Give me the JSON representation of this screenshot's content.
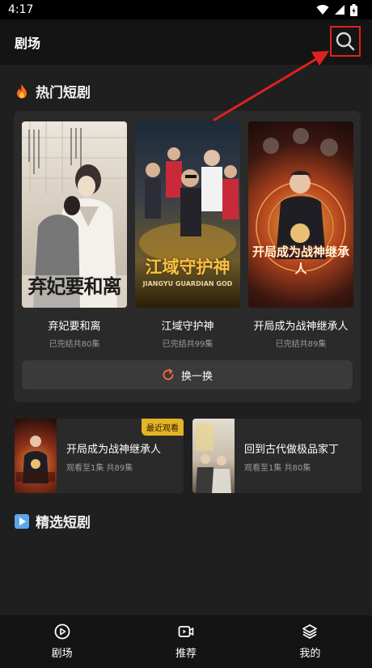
{
  "status_bar": {
    "time": "4:17"
  },
  "header": {
    "title": "剧场",
    "search_icon": "search-icon"
  },
  "hot_section": {
    "title": "热门短剧",
    "icon": "flame-icon",
    "items": [
      {
        "name": "弃妃要和离",
        "meta": "已完结共80集",
        "poster_text": "弃妃要和离"
      },
      {
        "name": "江域守护神",
        "meta": "已完结共99集",
        "poster_text": "江域守护神",
        "poster_subtext": "JIANGYU GUARDIAN GOD"
      },
      {
        "name": "开局成为战神继承人",
        "meta": "已完结共89集",
        "poster_text": "开局成为战神继承人"
      }
    ],
    "refresh_label": "换一换"
  },
  "recent": [
    {
      "title": "开局成为战神继承人",
      "meta": "观看至1集 共89集",
      "badge": "最近观看"
    },
    {
      "title": "回到古代做极品家丁",
      "meta": "观看至1集 共80集"
    }
  ],
  "featured_section": {
    "title": "精选短剧",
    "icon": "play-icon"
  },
  "bottom_nav": [
    {
      "label": "剧场",
      "icon": "play-circle-icon"
    },
    {
      "label": "推荐",
      "icon": "video-icon"
    },
    {
      "label": "我的",
      "icon": "layers-icon"
    }
  ],
  "colors": {
    "accent_red": "#e02020",
    "badge_gold": "#e6b326",
    "panel": "#2a2a2a",
    "background": "#1f1f1f"
  }
}
